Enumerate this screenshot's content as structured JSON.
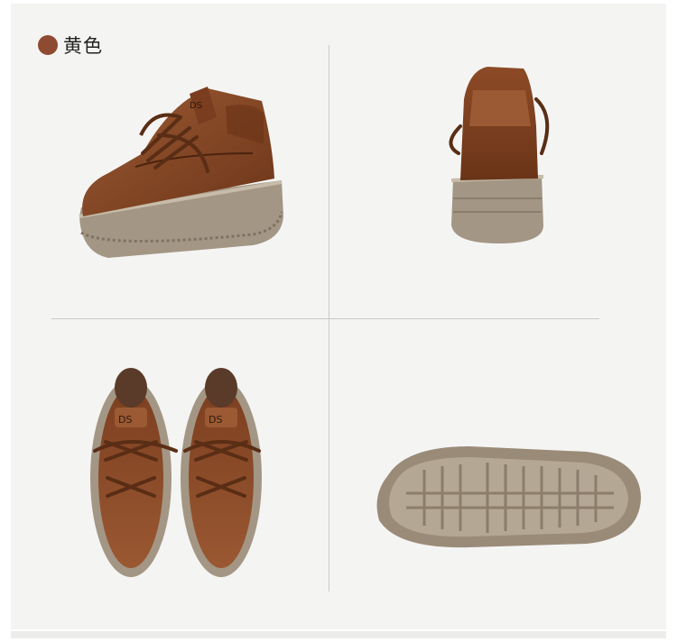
{
  "color_label": {
    "text": "黄色",
    "swatch_color": "#8e4b31"
  },
  "views": [
    {
      "name": "side-view",
      "icon": "shoe-side"
    },
    {
      "name": "back-view",
      "icon": "shoe-back"
    },
    {
      "name": "top-view",
      "icon": "shoe-pair-top"
    },
    {
      "name": "sole-view",
      "icon": "shoe-sole"
    }
  ],
  "colors": {
    "leather": "#8a4a28",
    "leather_dark": "#5e2f17",
    "sole": "#a39684",
    "sole_dark": "#7f7262",
    "background": "#f4f4f3"
  }
}
